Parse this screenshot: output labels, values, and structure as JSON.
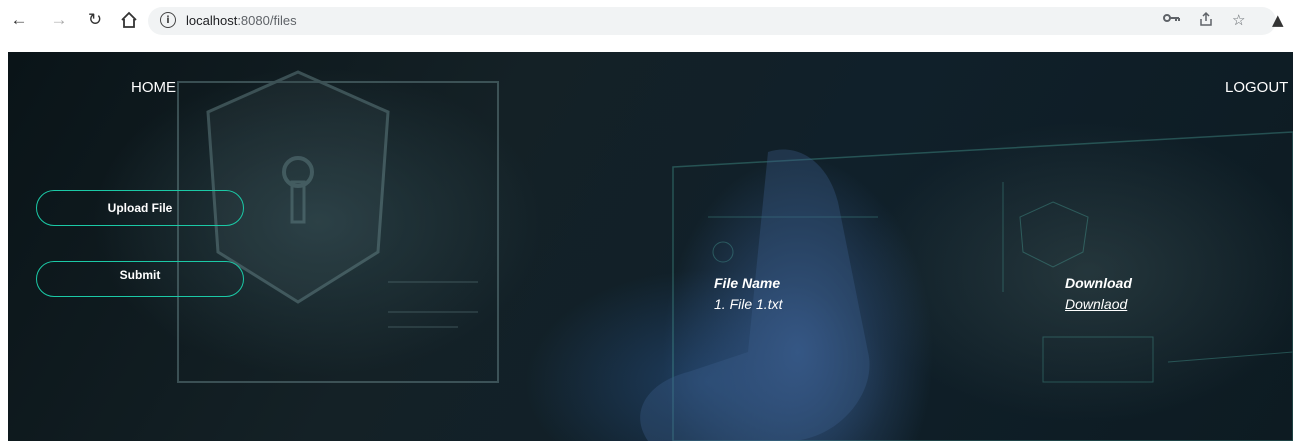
{
  "browser": {
    "url_host": "localhost",
    "url_path": ":8080/files",
    "icons": [
      "back-icon",
      "forward-icon",
      "reload-icon",
      "home-icon",
      "info-icon",
      "key-icon",
      "share-icon",
      "star-icon",
      "extensions-icon"
    ]
  },
  "nav": {
    "home": "HOME",
    "logout": "LOGOUT"
  },
  "actions": {
    "upload": "Upload File",
    "submit": "Submit"
  },
  "files_table": {
    "headers": [
      "File Name",
      "Download"
    ],
    "rows": [
      {
        "name": "1. File 1.txt",
        "download": "Downlaod"
      }
    ]
  },
  "colors": {
    "button_border": "#1bc9a6",
    "hero_bg": "#10202a"
  }
}
